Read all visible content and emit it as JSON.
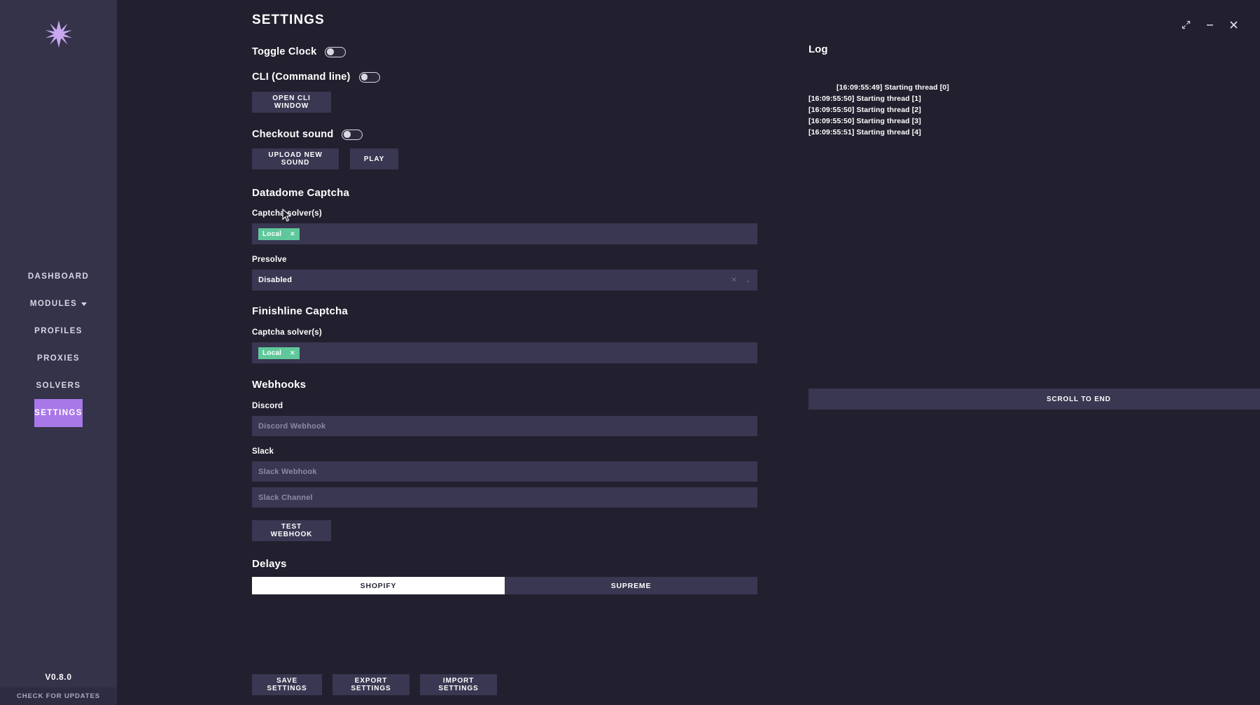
{
  "app": {
    "logo_icon": "sparkle-star-icon",
    "accent_color": "#a978e8",
    "version": "V0.8.0",
    "check_updates_label": "CHECK FOR UPDATES"
  },
  "window_controls": {
    "expand_icon": "expand-diagonal-icon",
    "minimize_icon": "minimize-icon",
    "close_icon": "close-icon"
  },
  "sidebar": {
    "items": [
      {
        "label": "DASHBOARD",
        "active": false,
        "has_caret": false
      },
      {
        "label": "MODULES",
        "active": false,
        "has_caret": true
      },
      {
        "label": "PROFILES",
        "active": false,
        "has_caret": false
      },
      {
        "label": "PROXIES",
        "active": false,
        "has_caret": false
      },
      {
        "label": "SOLVERS",
        "active": false,
        "has_caret": false
      },
      {
        "label": "SETTINGS",
        "active": true,
        "has_caret": false
      }
    ]
  },
  "header": {
    "title": "SETTINGS"
  },
  "settings": {
    "toggle_clock": {
      "label": "Toggle Clock",
      "state": "off"
    },
    "cli": {
      "label": "CLI (Command line)",
      "state": "off",
      "open_window_label": "OPEN CLI WINDOW"
    },
    "checkout_sound": {
      "label": "Checkout sound",
      "state": "off",
      "upload_label": "UPLOAD NEW SOUND",
      "play_label": "PLAY"
    },
    "datadome": {
      "section_title": "Datadome Captcha",
      "solver_label": "Captcha solver(s)",
      "solver_chips": [
        "Local"
      ],
      "presolve_label": "Presolve",
      "presolve_value": "Disabled"
    },
    "finishline": {
      "section_title": "Finishline Captcha",
      "solver_label": "Captcha solver(s)",
      "solver_chips": [
        "Local"
      ]
    },
    "webhooks": {
      "section_title": "Webhooks",
      "discord_label": "Discord",
      "discord_placeholder": "Discord Webhook",
      "discord_value": "",
      "slack_label": "Slack",
      "slack_webhook_placeholder": "Slack Webhook",
      "slack_webhook_value": "",
      "slack_channel_placeholder": "Slack Channel",
      "slack_channel_value": "",
      "test_label": "TEST WEBHOOK"
    },
    "delays": {
      "section_title": "Delays",
      "tabs": [
        {
          "label": "SHOPIFY",
          "active": true
        },
        {
          "label": "SUPREME",
          "active": false
        }
      ]
    },
    "actions": {
      "save_label": "SAVE SETTINGS",
      "export_label": "EXPORT SETTINGS",
      "import_label": "IMPORT SETTINGS"
    }
  },
  "log": {
    "title": "Log",
    "lines": [
      {
        "text": "[16:09:55:49] Starting thread [0]",
        "indented": true
      },
      {
        "text": "[16:09:55:50] Starting thread [1]",
        "indented": false
      },
      {
        "text": "[16:09:55:50] Starting thread [2]",
        "indented": false
      },
      {
        "text": "[16:09:55:50] Starting thread [3]",
        "indented": false
      },
      {
        "text": "[16:09:55:51] Starting thread [4]",
        "indented": false
      }
    ],
    "scroll_to_end_label": "SCROLL TO END"
  }
}
